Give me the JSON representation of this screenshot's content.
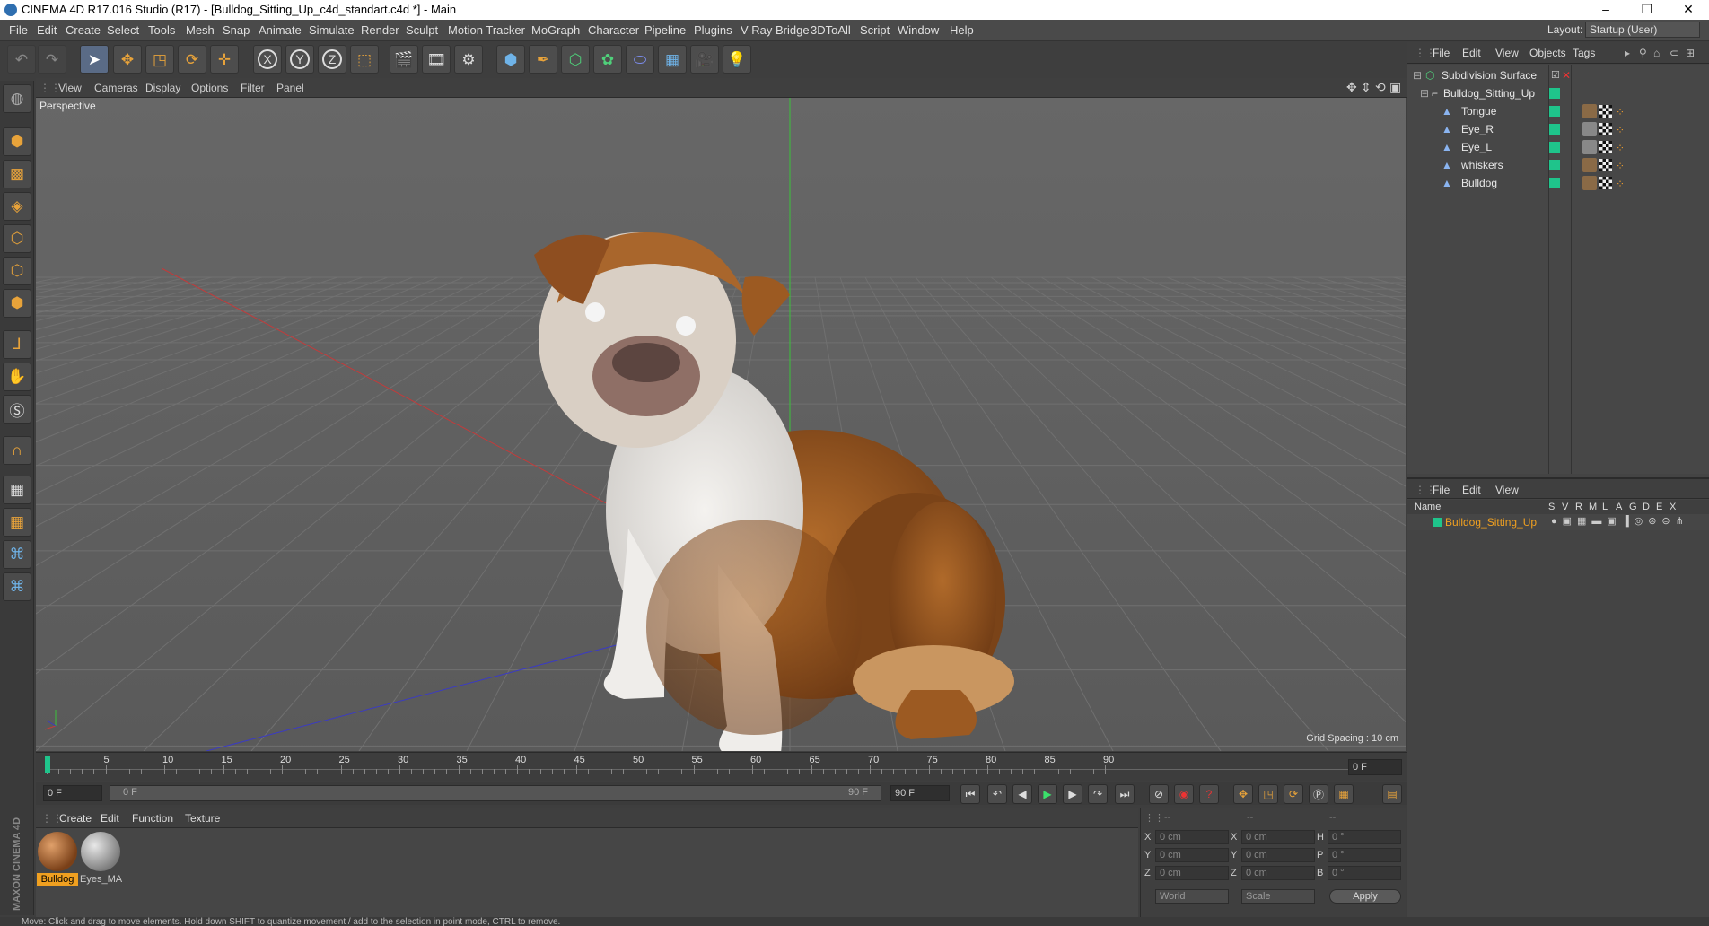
{
  "window": {
    "title": "CINEMA 4D R17.016 Studio (R17) - [Bulldog_Sitting_Up_c4d_standart.c4d *] - Main",
    "layout_label": "Layout:",
    "layout_value": "Startup (User)"
  },
  "menu": [
    "File",
    "Edit",
    "Create",
    "Select",
    "Tools",
    "Mesh",
    "Snap",
    "Animate",
    "Simulate",
    "Render",
    "Sculpt",
    "Motion Tracker",
    "MoGraph",
    "Character",
    "Pipeline",
    "Plugins",
    "V-Ray Bridge",
    "3DToAll",
    "Script",
    "Window",
    "Help"
  ],
  "toolbar": {
    "icons": [
      "undo-icon",
      "redo-icon",
      "select-arrow-icon",
      "move-icon",
      "scale-icon",
      "rotate-icon",
      "last-tool-icon",
      "x-axis-icon",
      "y-axis-icon",
      "z-axis-icon",
      "coordinate-system-icon",
      "render-view-icon",
      "render-picture-viewer-icon",
      "edit-render-settings-icon",
      "cube-icon",
      "pen-spline-icon",
      "subdivision-icon",
      "cloner-icon",
      "deformer-icon",
      "floor-icon",
      "camera-icon",
      "light-icon"
    ],
    "axis_labels": [
      "X",
      "Y",
      "Z"
    ]
  },
  "viewport": {
    "menu": [
      "View",
      "Cameras",
      "Display",
      "Options",
      "Filter",
      "Panel"
    ],
    "label": "Perspective",
    "grid_spacing": "Grid Spacing : 10 cm"
  },
  "object_manager": {
    "menu": [
      "File",
      "Edit",
      "View",
      "Objects",
      "Tags"
    ],
    "objects": [
      {
        "name": "Subdivision Surface",
        "indent": 0
      },
      {
        "name": "Bulldog_Sitting_Up",
        "indent": 1
      },
      {
        "name": "Tongue",
        "indent": 2
      },
      {
        "name": "Eye_R",
        "indent": 2
      },
      {
        "name": "Eye_L",
        "indent": 2
      },
      {
        "name": "whiskers",
        "indent": 2
      },
      {
        "name": "Bulldog",
        "indent": 2
      }
    ]
  },
  "layer_manager": {
    "menu": [
      "File",
      "Edit",
      "View"
    ],
    "columns": {
      "name": "Name",
      "flags": [
        "S",
        "V",
        "R",
        "M",
        "L",
        "A",
        "G",
        "D",
        "E",
        "X"
      ]
    },
    "rows": [
      "Bulldog_Sitting_Up"
    ]
  },
  "timeline": {
    "ticks": [
      "0",
      "5",
      "10",
      "15",
      "20",
      "25",
      "30",
      "35",
      "40",
      "45",
      "50",
      "55",
      "60",
      "65",
      "70",
      "75",
      "80",
      "85",
      "90"
    ],
    "current_frame": "0 F",
    "start_field": "0 F",
    "range_start": "0 F",
    "range_end": "90 F",
    "end_field": "90 F"
  },
  "material_manager": {
    "menu": [
      "Create",
      "Edit",
      "Function",
      "Texture"
    ],
    "materials": [
      {
        "name": "Bulldog",
        "selected": true
      },
      {
        "name": "Eyes_MA",
        "selected": false
      }
    ]
  },
  "coordinates": {
    "headers": [
      "--",
      "--",
      "--"
    ],
    "rows": [
      {
        "a": "X",
        "av": "0 cm",
        "b": "X",
        "bv": "0 cm",
        "c": "H",
        "cv": "0 °"
      },
      {
        "a": "Y",
        "av": "0 cm",
        "b": "Y",
        "bv": "0 cm",
        "c": "P",
        "cv": "0 °"
      },
      {
        "a": "Z",
        "av": "0 cm",
        "b": "Z",
        "bv": "0 cm",
        "c": "B",
        "cv": "0 °"
      }
    ],
    "world": "World",
    "scale": "Scale",
    "apply": "Apply"
  },
  "status": "Move: Click and drag to move elements. Hold down SHIFT to quantize movement / add to the selection in point mode, CTRL to remove.",
  "brand": "MAXON CINEMA 4D",
  "colors": {
    "accent": "#e8a33a",
    "selected_material": "#f0a020",
    "layer_color": "#1fc48b",
    "axis_x": "#c23b3b",
    "axis_z": "#3b3bc2",
    "axis_y": "#3bc23b"
  }
}
